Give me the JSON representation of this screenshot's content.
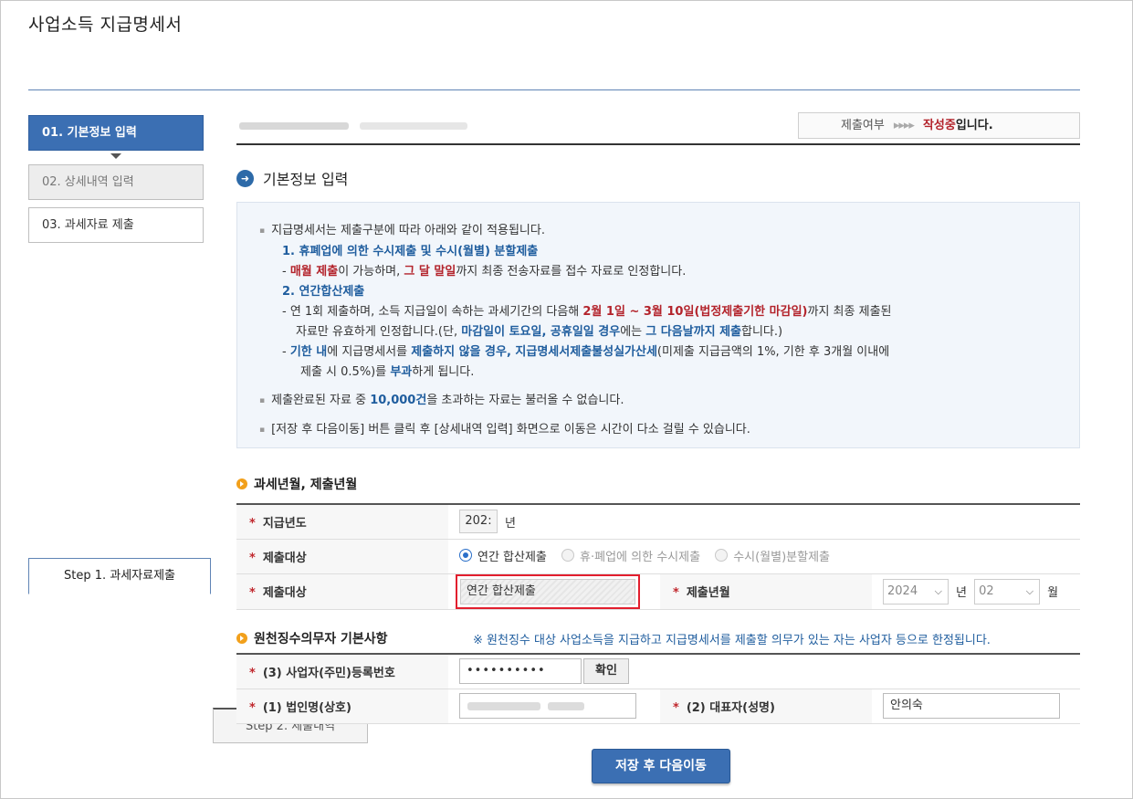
{
  "page_title": "사업소득 지급명세서",
  "steps": [
    {
      "label": "Step 1. 과세자료제출",
      "active": true
    },
    {
      "label": "Step 2. 제출내역",
      "active": false
    }
  ],
  "sidebar": {
    "items": [
      {
        "label": "01. 기본정보 입력",
        "state": "active"
      },
      {
        "label": "02. 상세내역 입력",
        "state": "done"
      },
      {
        "label": "03. 과세자료 제출",
        "state": "normal"
      }
    ]
  },
  "status": {
    "label": "제출여부",
    "arrows": "▸▸▸▸",
    "value": "작성중",
    "suffix": "입니다."
  },
  "section_title": "기본정보 입력",
  "info": {
    "line1": "지급명세서는 제출구분에 따라 아래와 같이 적용됩니다.",
    "item1_title": "1. 휴폐업에 의한 수시제출 및 수시(월별) 분할제출",
    "item1_desc_prefix": "- ",
    "item1_desc_a": "매월 제출",
    "item1_desc_b": "이 가능하며, ",
    "item1_desc_c": "그 달 말일",
    "item1_desc_d": "까지 최종 전송자료를 접수 자료로 인정합니다.",
    "item2_title": "2. 연간합산제출",
    "item2_a": "- 연 1회 제출하며, 소득 지급일이 속하는 과세기간의 다음해 ",
    "item2_b": "2월 1일 ~ 3월 10일(법정제출기한 마감일)",
    "item2_c": "까지 최종 제출된",
    "item2_d": "자료만 유효하게 인정합니다.(단, ",
    "item2_e": "마감일이 토요일, 공휴일일 경우",
    "item2_f": "에는 ",
    "item2_g": "그 다음날까지 제출",
    "item2_h": "합니다.)",
    "item3_a": "- ",
    "item3_b": "기한 내",
    "item3_c": "에 지급명세서를 ",
    "item3_d": "제출하지 않을 경우, 지급명세서제출불성실가산세",
    "item3_e": "(미제출 지급금액의 1%, 기한 후 3개월 이내에",
    "item3_f": "제출 시 0.5%)를 ",
    "item3_g": "부과",
    "item3_h": "하게 됩니다.",
    "line2_a": "제출완료된 자료 중 ",
    "line2_b": "10,000건",
    "line2_c": "을 초과하는 자료는 불러올 수 없습니다.",
    "line3": "[저장 후 다음이동] 버튼 클릭 후 [상세내역 입력] 화면으로 이동은 시간이 다소 걸릴 수 있습니다."
  },
  "period_section": {
    "title": "과세년월, 제출년월",
    "pay_year_label": "지급년도",
    "pay_year_value": "202:",
    "year_unit": "년",
    "target_label": "제출대상",
    "radios": [
      {
        "label": "연간 합산제출",
        "checked": true
      },
      {
        "label": "휴·폐업에 의한 수시제출",
        "checked": false
      },
      {
        "label": "수시(월별)분할제출",
        "checked": false
      }
    ],
    "target2_label": "제출대상",
    "target2_value": "연간 합산제출",
    "submit_ym_label": "제출년월",
    "submit_year": "2024",
    "submit_year_unit": "년",
    "submit_month": "02",
    "submit_month_unit": "월"
  },
  "payer_section": {
    "title": "원천징수의무자 기본사항",
    "notice": "※ 원천징수 대상 사업소득을 지급하고 지급명세서를 제출할 의무가 있는 자는 사업자 등으로 한정됩니다.",
    "reg_label": "(3) 사업자(주민)등록번호",
    "reg_value": "••••••••••",
    "confirm_label": "확인",
    "corp_label": "(1) 법인명(상호)",
    "rep_label": "(2) 대표자(성명)",
    "rep_value": "안의숙"
  },
  "required_mark": "*",
  "primary_button": "저장 후 다음이동"
}
